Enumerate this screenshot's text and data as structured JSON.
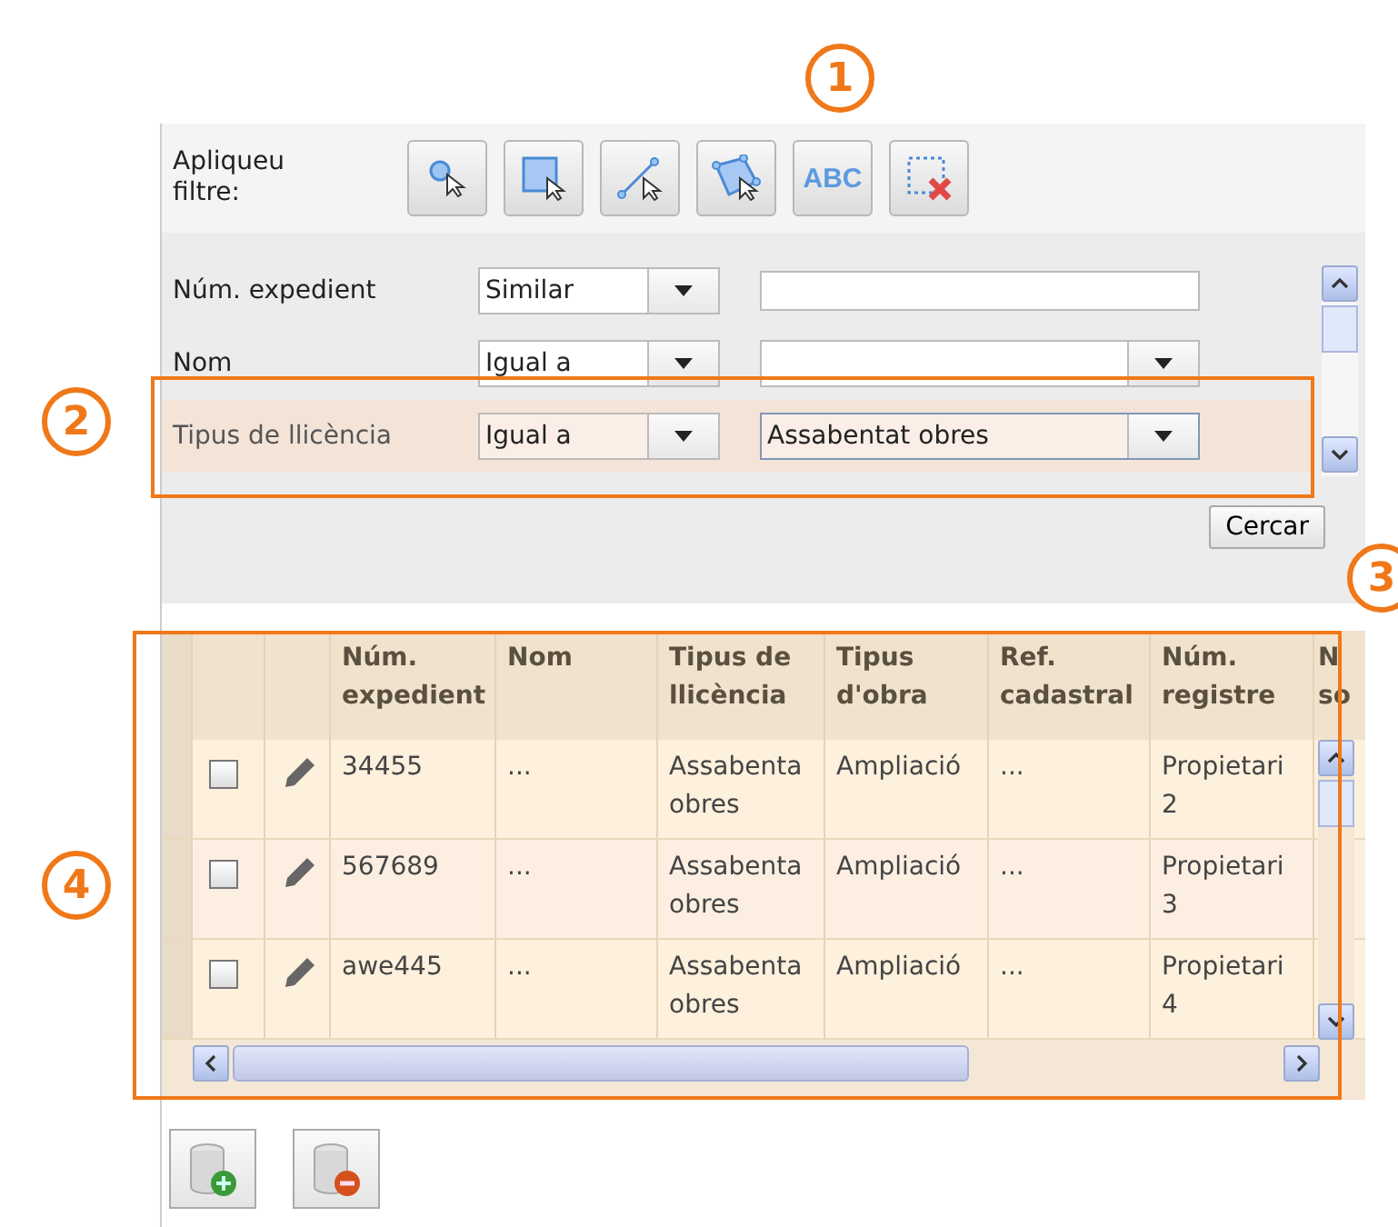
{
  "toolbar": {
    "label": "Apliqueu filtre:",
    "tools": [
      {
        "kind": "point"
      },
      {
        "kind": "rectangle"
      },
      {
        "kind": "line"
      },
      {
        "kind": "polygon"
      },
      {
        "kind": "text",
        "text": "ABC"
      },
      {
        "kind": "clear"
      }
    ]
  },
  "filters": [
    {
      "label": "Núm. expedient",
      "operator": "Similar",
      "kind": "text",
      "highlighted": false
    },
    {
      "label": "Nom",
      "operator": "Igual a",
      "kind": "combo",
      "highlighted": false
    },
    {
      "label": "Tipus de llicència",
      "operator": "Igual a",
      "value": "Assabentat obres",
      "kind": "combo",
      "highlighted": true
    }
  ],
  "search_button": "Cercar",
  "table": {
    "columns": [
      "Núm. expedient",
      "Nom",
      "Tipus de llicència",
      "Tipus d'obra",
      "Ref. cadastral",
      "Núm. registre",
      "N so"
    ],
    "rows": [
      {
        "checked": false,
        "cells": [
          "34455",
          "...",
          "Assabenta obres",
          "Ampliació",
          "...",
          "Propietari 2"
        ]
      },
      {
        "checked": false,
        "cells": [
          "567689",
          "...",
          "Assabenta obres",
          "Ampliació",
          "...",
          "Propietari 3"
        ]
      },
      {
        "checked": false,
        "cells": [
          "awe445",
          "...",
          "Assabenta obres",
          "Ampliació",
          "...",
          "Propietari 4"
        ]
      }
    ]
  },
  "bottom_buttons": [
    {
      "kind": "add"
    },
    {
      "kind": "remove"
    }
  ],
  "callouts": [
    "1",
    "2",
    "3",
    "4"
  ]
}
